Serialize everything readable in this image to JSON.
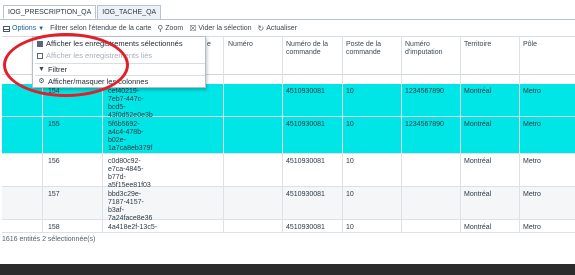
{
  "tabs": [
    "IOG_PRESCRIPTION_QA",
    "IOG_TACHE_QA"
  ],
  "toolbar": {
    "options_label": "Options",
    "filter_extent_label": "Filtrer selon l'étendue de la carte",
    "zoom_label": "Zoom",
    "clear_selection_label": "Vider la sélection",
    "refresh_label": "Actualiser"
  },
  "menu": {
    "show_selected": "Afficher les enregistrements sélectionnés",
    "show_related": "Afficher les enregistrements liés",
    "filter": "Filtrer",
    "toggle_columns": "Afficher/masquer les colonnes"
  },
  "columns": {
    "c1": "e",
    "c2": "Numéro",
    "c3": "Numéro de la commande",
    "c4": "Poste de la commande",
    "c5": "Numéro d'imputation",
    "c6": "Territoire",
    "c7": "Pôle"
  },
  "rows": [
    {
      "id": "154",
      "guid": "cef40219-7eb7-447c-bcd5-43f0d52e0e3b",
      "commande": "4510930081",
      "poste": "10",
      "imputation": "1234567890",
      "territoire": "Montréal",
      "pole": "Metro"
    },
    {
      "id": "155",
      "guid": "5f6b5692-a4c4-478b-b02e-1a7ca8eb379f",
      "commande": "4510930081",
      "poste": "10",
      "imputation": "1234567890",
      "territoire": "Montréal",
      "pole": "Metro"
    },
    {
      "id": "156",
      "guid": "c0d80c92-e7ca-4845-b77d-a5f15ee81f03",
      "commande": "4510930081",
      "poste": "10",
      "imputation": "",
      "territoire": "Montréal",
      "pole": "Metro"
    },
    {
      "id": "157",
      "guid": "bbd3c29e-7187-4157-b3af-7a24face8e36",
      "commande": "4510930081",
      "poste": "10",
      "imputation": "",
      "territoire": "Montréal",
      "pole": "Metro"
    },
    {
      "id": "158",
      "guid": "4a418e2f-13c5-",
      "commande": "4510930081",
      "poste": "10",
      "imputation": "",
      "territoire": "Montréal",
      "pole": "Metro"
    }
  ],
  "footer": "1616 entités  2 sélectionnée(s)",
  "colors": {
    "selected_row": "#00e6e6",
    "highlight_ring": "#e0202a"
  }
}
